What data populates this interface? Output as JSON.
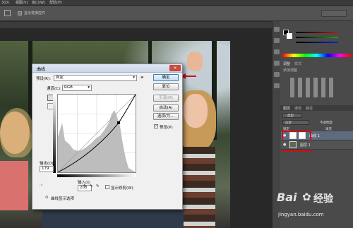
{
  "menubar": {
    "items": [
      "3(D)",
      "视图(V)",
      "窗口(W)",
      "帮助(H)"
    ]
  },
  "options": {
    "checkbox_label": "显示变换控件"
  },
  "dialog": {
    "title": "曲线",
    "preset_label": "预设(R):",
    "preset_value": "自定",
    "channel_label": "通道(C):",
    "channel_value": "RGB",
    "buttons": {
      "ok": "确定",
      "reset": "复位",
      "smooth": "平滑(M)",
      "auto": "自动(A)",
      "options": "选项(T)..."
    },
    "preview_label": "预览(P)",
    "preview_checked": true,
    "output_label": "输出(O):",
    "output_value": "179",
    "input_label": "输入(I):",
    "input_value": "200",
    "show_clipping_label": "显示修剪(W)",
    "curve_display_label": "曲线显示选项"
  },
  "layers": {
    "tabs": [
      "图层",
      "通道",
      "路径"
    ],
    "kind": "类型",
    "mode": "正常",
    "opacity_label": "不透明度",
    "fill_label": "填充",
    "lock_label": "锁定",
    "rows": [
      {
        "name": "曲线 1",
        "selected": true
      },
      {
        "name": "图层 1",
        "selected": false
      }
    ]
  },
  "adjust_panel": {
    "tabs": [
      "调整",
      "样式"
    ],
    "title": "添加调整"
  },
  "watermark": {
    "brand": "Bai",
    "text": "经验",
    "url": "jingyan.baidu.com"
  },
  "colors": {
    "accent_red": "#cc1111",
    "ok_border": "#3c7fb1"
  }
}
